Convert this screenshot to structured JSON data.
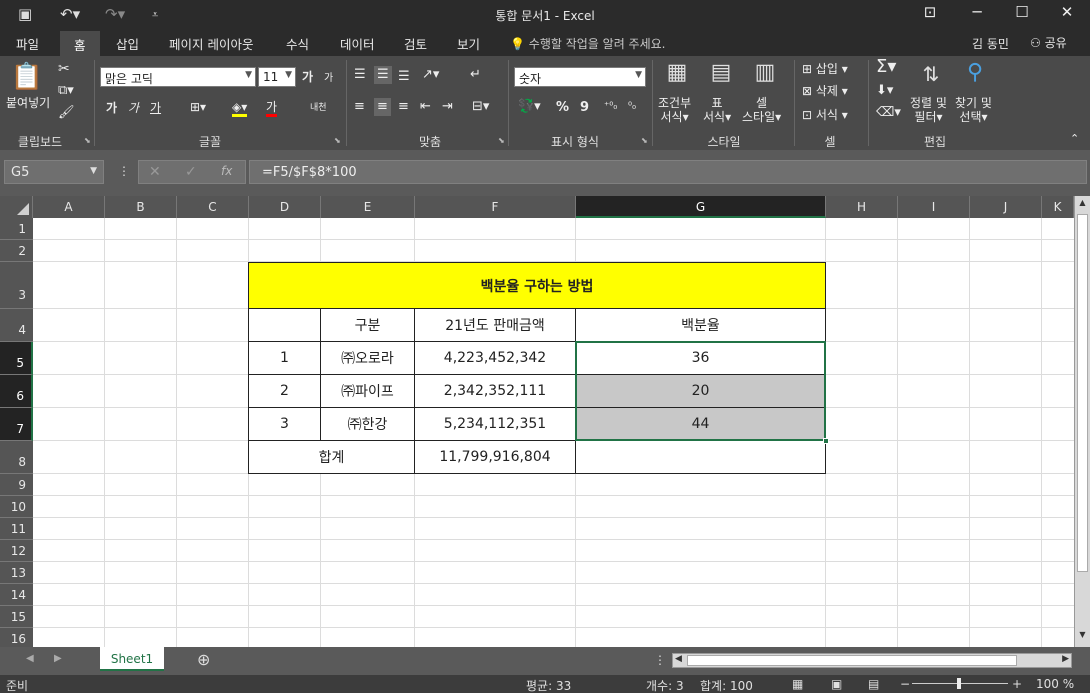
{
  "window": {
    "title": "통합 문서1 - Excel"
  },
  "quick_access": {
    "save_icon": "save-icon",
    "undo_icon": "undo-icon",
    "redo_icon": "redo-icon",
    "customize_icon": "customize-icon"
  },
  "tabs": {
    "file": "파일",
    "home": "홈",
    "insert": "삽입",
    "page_layout": "페이지 레이아웃",
    "formulas": "수식",
    "data": "데이터",
    "review": "검토",
    "view": "보기"
  },
  "tell_me": "수행할 작업을 알려 주세요.",
  "user": {
    "name": "김 동민",
    "share": "공유"
  },
  "ribbon": {
    "clipboard": {
      "paste": "붙여넣기",
      "label": "클립보드"
    },
    "font": {
      "name": "맑은 고딕",
      "size": "11",
      "grow": "가",
      "shrink": "가",
      "bold": "가",
      "italic": "가",
      "underline": "가",
      "color_a": "가",
      "phonetic": "내천",
      "label": "글꼴"
    },
    "alignment": {
      "label": "맞춤"
    },
    "number": {
      "format": "숫자",
      "percent": "%",
      "comma": "9",
      "label": "표시 형식"
    },
    "styles": {
      "conditional_1": "조건부",
      "conditional_2": "서식",
      "table_1": "표",
      "table_2": "서식",
      "cell_styles_1": "셀",
      "cell_styles_2": "스타일",
      "label": "스타일"
    },
    "cells": {
      "insert": "삽입",
      "delete": "삭제",
      "format": "서식",
      "label": "셀"
    },
    "editing": {
      "sort_1": "정렬 및",
      "sort_2": "필터",
      "find_1": "찾기 및",
      "find_2": "선택",
      "label": "편집"
    }
  },
  "formula_bar": {
    "name_box": "G5",
    "formula": "=F5/$F$8*100",
    "cancel": "✕",
    "enter": "✓",
    "fx": "fx"
  },
  "columns": [
    "A",
    "B",
    "C",
    "D",
    "E",
    "F",
    "G",
    "H",
    "I",
    "J",
    "K"
  ],
  "rows": [
    "1",
    "2",
    "3",
    "4",
    "5",
    "6",
    "7",
    "8",
    "9",
    "10",
    "11",
    "12",
    "13",
    "14",
    "15",
    "16"
  ],
  "table": {
    "title": "백분율 구하는 방법",
    "headers": [
      "구분",
      "21년도 판매금액",
      "백분율"
    ],
    "rows": [
      {
        "no": "1",
        "name": "㈜오로라",
        "amount": "4,223,452,342",
        "percent": "36"
      },
      {
        "no": "2",
        "name": "㈜파이프",
        "amount": "2,342,352,111",
        "percent": "20"
      },
      {
        "no": "3",
        "name": "㈜한강",
        "amount": "5,234,112,351",
        "percent": "44"
      }
    ],
    "total_label": "합계",
    "total_amount": "11,799,916,804"
  },
  "sheet_tabs": [
    "Sheet1"
  ],
  "status": {
    "mode": "준비",
    "average": "평균: 33",
    "count": "개수: 3",
    "sum": "합계: 100",
    "zoom": "100 %"
  },
  "colors": {
    "title_fill": "#ffff00",
    "selection_fill": "#c8c8c8",
    "accent": "#217346"
  }
}
